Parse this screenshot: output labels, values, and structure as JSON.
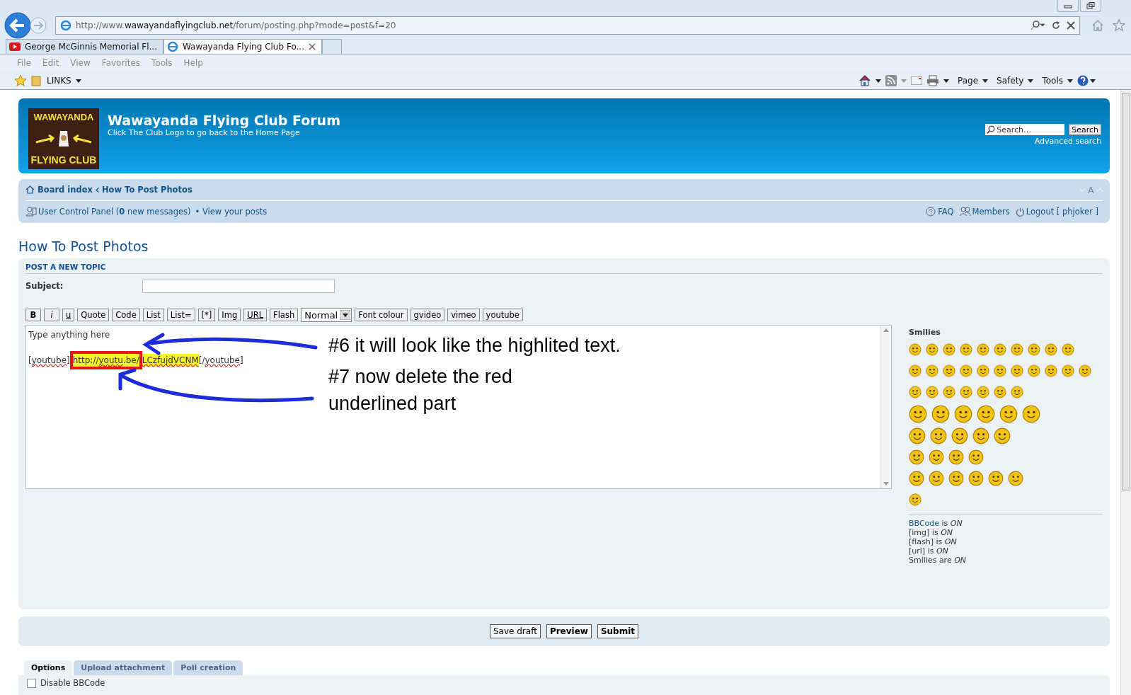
{
  "browser": {
    "url_start": "http://www.",
    "url_domain": "wawayandaflyingclub.net",
    "url_rest": "/forum/posting.php?mode=post&f=20",
    "tabs": [
      {
        "title": "George McGinnis Memorial Fl...",
        "kind": "video",
        "selected": false
      },
      {
        "title": "Wawayanda Flying Club Fo...",
        "kind": "web",
        "selected": true
      }
    ],
    "menu": [
      "File",
      "Edit",
      "View",
      "Favorites",
      "Tools",
      "Help"
    ],
    "favorites_folder": "LINKS",
    "commands": [
      "Page",
      "Safety",
      "Tools"
    ]
  },
  "header": {
    "logo_top": "WAWAYANDA",
    "logo_bottom": "FLYING CLUB",
    "title": "Wawayanda Flying Club Forum",
    "subtitle": "Click The Club Logo to go back to the Home Page",
    "search_placeholder": "Search…",
    "search_button": "Search",
    "advanced_search": "Advanced search"
  },
  "nav": {
    "crumbs": [
      "Board index",
      "How To Post Photos"
    ],
    "font_size": "A",
    "ucp": "User Control Panel (**0** new messages)",
    "view_posts": "• View your posts",
    "links": [
      {
        "label": "FAQ",
        "kind": "faq"
      },
      {
        "label": "Members",
        "kind": "members"
      },
      {
        "label": "Logout [ phjoker ]",
        "kind": "logout"
      }
    ]
  },
  "page_title": "How To Post Photos",
  "form": {
    "heading": "POST A NEW TOPIC",
    "subject_label": "Subject:",
    "toolbar": [
      {
        "label": "B",
        "kind": "bold"
      },
      {
        "label": "i",
        "kind": "italic"
      },
      {
        "label": "u",
        "kind": "underline"
      },
      {
        "label": "Quote",
        "kind": "plain"
      },
      {
        "label": "Code",
        "kind": "plain"
      },
      {
        "label": "List",
        "kind": "plain"
      },
      {
        "label": "List=",
        "kind": "plain"
      },
      {
        "label": "[*]",
        "kind": "plain"
      },
      {
        "label": "Img",
        "kind": "plain"
      },
      {
        "label": "URL",
        "kind": "underline"
      },
      {
        "label": "Flash",
        "kind": "plain"
      },
      {
        "label": "Normal",
        "kind": "select"
      },
      {
        "label": "Font colour",
        "kind": "plain"
      },
      {
        "label": "gvideo",
        "kind": "plain"
      },
      {
        "label": "vimeo",
        "kind": "plain"
      },
      {
        "label": "youtube",
        "kind": "plain"
      }
    ],
    "editor": {
      "first_line": "Type anything here",
      "segments": [
        {
          "text": "[",
          "misspelled": false,
          "highlight": false,
          "boxed": false
        },
        {
          "text": "youtube",
          "misspelled": true,
          "highlight": false,
          "boxed": false
        },
        {
          "text": "]",
          "misspelled": false,
          "highlight": false,
          "boxed": false
        },
        {
          "text": "http://",
          "misspelled": false,
          "highlight": true,
          "boxed": true
        },
        {
          "text": "youtu",
          "misspelled": true,
          "highlight": true,
          "boxed": true
        },
        {
          "text": ".be/",
          "misspelled": false,
          "highlight": true,
          "boxed": true
        },
        {
          "text": "LCzfujdVCNM",
          "misspelled": true,
          "highlight": true,
          "boxed": false
        },
        {
          "text": "[/",
          "misspelled": false,
          "highlight": false,
          "boxed": false
        },
        {
          "text": "youtube",
          "misspelled": true,
          "highlight": false,
          "boxed": false
        },
        {
          "text": "]",
          "misspelled": false,
          "highlight": false,
          "boxed": false
        }
      ]
    },
    "annotations": [
      {
        "lines": [
          "#6 it will look like the highlited text."
        ]
      },
      {
        "lines": [
          "#7 now delete the red",
          "underlined part"
        ]
      }
    ],
    "smilies_title": "Smilies",
    "status": [
      {
        "label": "BBCode",
        "state": "is *ON*",
        "link": true
      },
      {
        "label": "[img]",
        "state": "is *ON*",
        "link": false
      },
      {
        "label": "[flash]",
        "state": "is *ON*",
        "link": false
      },
      {
        "label": "[url]",
        "state": "is *ON*",
        "link": false
      },
      {
        "label": "Smilies",
        "state": "are *ON*",
        "link": false
      }
    ],
    "buttons": [
      {
        "label": "Save draft",
        "kind": "default"
      },
      {
        "label": "Preview",
        "kind": "primary"
      },
      {
        "label": "Submit",
        "kind": "primary"
      }
    ],
    "option_tabs": [
      {
        "label": "Options",
        "selected": true
      },
      {
        "label": "Upload attachment",
        "selected": false
      },
      {
        "label": "Poll creation",
        "selected": false
      }
    ],
    "options": [
      {
        "label": "Disable BBCode",
        "checked": false
      }
    ]
  }
}
